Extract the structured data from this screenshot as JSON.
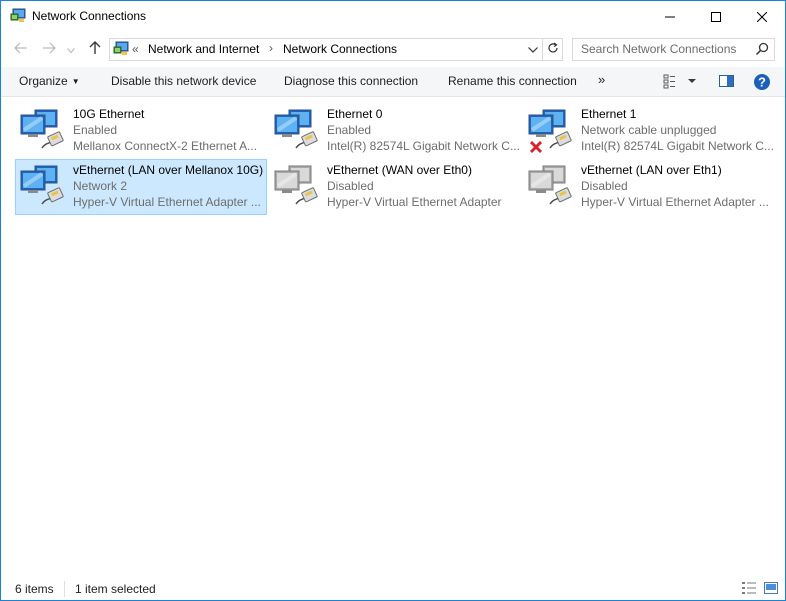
{
  "window": {
    "title": "Network Connections"
  },
  "address": {
    "overflow": "«",
    "crumbs": [
      "Network and Internet",
      "Network Connections"
    ],
    "separator": "›"
  },
  "search": {
    "placeholder": "Search Network Connections"
  },
  "commands": {
    "organize": "Organize",
    "disable": "Disable this network device",
    "diagnose": "Diagnose this connection",
    "rename": "Rename this connection",
    "more": "»"
  },
  "connections": [
    {
      "name": "10G Ethernet",
      "status": "Enabled",
      "device": "Mellanox ConnectX-2 Ethernet A...",
      "state": "enabled"
    },
    {
      "name": "Ethernet 0",
      "status": "Enabled",
      "device": "Intel(R) 82574L Gigabit Network C...",
      "state": "enabled"
    },
    {
      "name": "Ethernet 1",
      "status": "Network cable unplugged",
      "device": "Intel(R) 82574L Gigabit Network C...",
      "state": "unplugged"
    },
    {
      "name": "vEthernet (LAN over Mellanox 10G)",
      "status": "Network  2",
      "device": "Hyper-V Virtual Ethernet Adapter ...",
      "state": "enabled",
      "selected": true
    },
    {
      "name": "vEthernet (WAN over Eth0)",
      "status": "Disabled",
      "device": "Hyper-V Virtual Ethernet Adapter",
      "state": "disabled"
    },
    {
      "name": "vEthernet (LAN over Eth1)",
      "status": "Disabled",
      "device": "Hyper-V Virtual Ethernet Adapter ...",
      "state": "disabled"
    }
  ],
  "status": {
    "count": "6 items",
    "selection": "1 item selected"
  },
  "colors": {
    "accent": "#1883d7",
    "selection": "#cce8ff",
    "help": "#1c5fb8",
    "error": "#d8232a"
  },
  "icons": {
    "title": "network-connections-icon",
    "back": "back-arrow-icon",
    "forward": "forward-arrow-icon",
    "up": "up-arrow-icon",
    "search": "search-icon",
    "refresh": "refresh-icon",
    "help": "help-icon"
  }
}
